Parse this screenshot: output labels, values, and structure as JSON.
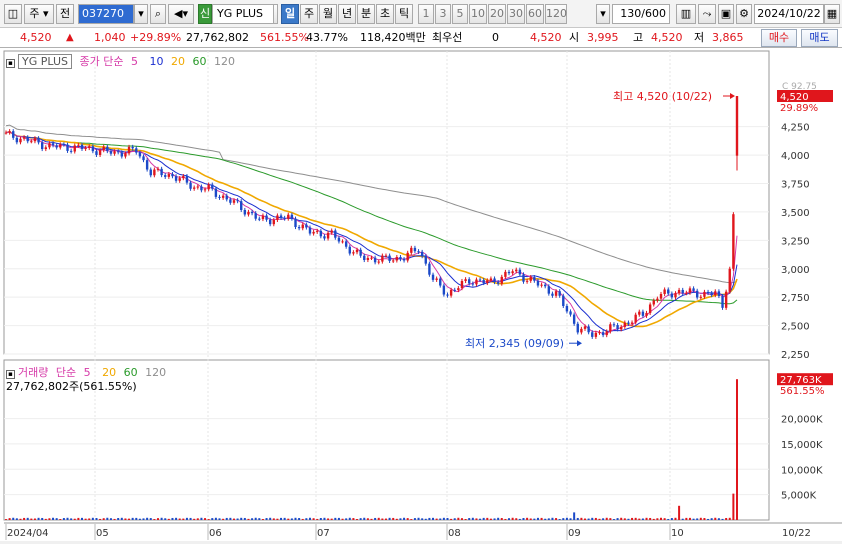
{
  "toolbar": {
    "market": "주",
    "prev_label": "전",
    "code": "037270",
    "badge": "신",
    "name": "YG PLUS",
    "period_tabs": [
      "일",
      "주",
      "월",
      "년",
      "분",
      "초",
      "틱"
    ],
    "interval_buttons": [
      "1",
      "3",
      "5",
      "10",
      "20",
      "30",
      "60",
      "120"
    ],
    "count": "130/600",
    "date": "2024/10/22"
  },
  "quote": {
    "price": "4,520",
    "change": "1,040",
    "change_pct": "+29.89%",
    "volume": "27,762,802",
    "volume_ratio": "561.55%",
    "turnover_rate": "43.77%",
    "amount": "118,420백만",
    "preferred_label": "최우선",
    "preferred_value": "0",
    "bid": "4,520",
    "open_label": "시",
    "open": "3,995",
    "high_label": "고",
    "high": "4,520",
    "low_label": "저",
    "low": "3,865",
    "buy_label": "매수",
    "sell_label": "매도"
  },
  "price_panel": {
    "legend_name": "YG PLUS",
    "legend_type": "종가 단순",
    "ma_labels": [
      "5",
      "10",
      "20",
      "60",
      "120"
    ],
    "colors": {
      "ma5": "#d63aa8",
      "ma10": "#1b2fd0",
      "ma20": "#f0a800",
      "ma60": "#2a9a2a",
      "ma120": "#8e8e8e",
      "up": "#e0161c",
      "down": "#1b49c8"
    },
    "current_price": "4,520",
    "current_change": "29.89%",
    "top_cut_label": "C 92.75",
    "high_annotation": "최고 4,520 (10/22)",
    "low_annotation": "최저 2,345 (09/09)",
    "y_ticks": [
      "4,250",
      "4,000",
      "3,750",
      "3,500",
      "3,250",
      "3,000",
      "2,750",
      "2,500",
      "2,250"
    ]
  },
  "volume_panel": {
    "legend_name": "거래량",
    "legend_type": "단순",
    "ma_labels": [
      "5",
      "20",
      "60",
      "120"
    ],
    "summary": "27,762,802주(561.55%)",
    "current_volume": "27,763K",
    "current_ratio": "561.55%",
    "y_ticks": [
      "20,000K",
      "15,000K",
      "10,000K",
      "5,000K"
    ]
  },
  "x_axis": {
    "labels": [
      "2024/04",
      "05",
      "06",
      "07",
      "08",
      "09",
      "10"
    ],
    "last_date": "10/22"
  },
  "chart_data": {
    "type": "candlestick",
    "y_range": [
      2250,
      4520
    ],
    "volume_unit": "K",
    "summary_points": [
      {
        "label": "최고",
        "date": "10/22",
        "price": 4520
      },
      {
        "label": "최저",
        "date": "09/09",
        "price": 2345
      }
    ],
    "last_candle": {
      "date": "10/22",
      "open": 3995,
      "high": 4520,
      "low": 3865,
      "close": 4520,
      "volume_k": 27763
    }
  }
}
